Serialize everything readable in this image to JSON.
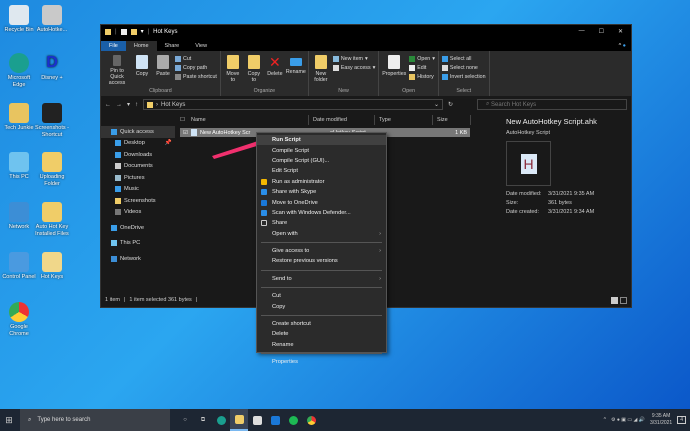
{
  "desktop": {
    "icons": [
      "Recycle Bin",
      "AutoHotke...",
      "Microsoft Edge",
      "Disney +",
      "Tech Junkie",
      "Screenshots - Shortcut",
      "This PC",
      "Uploading Folder",
      "Network",
      "Auto Hot Key Installed Files",
      "Control Panel",
      "Hot Keys",
      "Google Chrome"
    ]
  },
  "window": {
    "title": "Hot Keys",
    "tabs": [
      "File",
      "Home",
      "Share",
      "View"
    ],
    "ribbon": {
      "clipboard": {
        "label": "Clipboard",
        "pin": "Pin to Quick access",
        "copy": "Copy",
        "paste": "Paste",
        "cut": "Cut",
        "copy_path": "Copy path",
        "paste_shortcut": "Paste shortcut"
      },
      "organize": {
        "label": "Organize",
        "move_to": "Move to",
        "copy_to": "Copy to",
        "delete": "Delete",
        "rename": "Rename"
      },
      "new": {
        "label": "New",
        "new_folder": "New folder",
        "new_item": "New item",
        "easy_access": "Easy access"
      },
      "open": {
        "label": "Open",
        "properties": "Properties",
        "open": "Open",
        "edit": "Edit",
        "history": "History"
      },
      "select": {
        "label": "Select",
        "select_all": "Select all",
        "select_none": "Select none",
        "invert": "Invert selection"
      }
    },
    "address": {
      "path": "Hot Keys",
      "search_placeholder": "Search Hot Keys"
    },
    "nav": {
      "items": [
        "Quick access",
        "Desktop",
        "Downloads",
        "Documents",
        "Pictures",
        "Music",
        "Screenshots",
        "Videos",
        "OneDrive",
        "This PC",
        "Network"
      ]
    },
    "columns": [
      "Name",
      "Date modified",
      "Type",
      "Size"
    ],
    "file": {
      "name": "New AutoHotkey Script.ahk",
      "name_visible": "New AutoHotkey Scr",
      "type": "AutoHotkey Script",
      "type_visible": "oHotkey Script",
      "size": "1 KB"
    },
    "preview": {
      "title": "New AutoHotkey Script.ahk",
      "subtitle": "AutoHotkey Script",
      "date_modified_label": "Date modified:",
      "date_modified": "3/31/2021 9:35 AM",
      "size_label": "Size:",
      "size": "361 bytes",
      "date_created_label": "Date created:",
      "date_created": "3/31/2021 9:34 AM"
    },
    "status": {
      "count": "1 item",
      "selected": "1 item selected  361 bytes"
    }
  },
  "context_menu": {
    "items": [
      "Run Script",
      "Compile Script",
      "Compile Script (GUI)...",
      "Edit Script",
      "Run as administrator",
      "Share with Skype",
      "Move to OneDrive",
      "Scan with Windows Defender...",
      "Share",
      "Open with",
      "Give access to",
      "Restore previous versions",
      "Send to",
      "Cut",
      "Copy",
      "Create shortcut",
      "Delete",
      "Rename",
      "Properties"
    ]
  },
  "taskbar": {
    "search_placeholder": "Type here to search",
    "time": "9:35 AM",
    "date": "3/31/2021",
    "notification_count": "4"
  },
  "colors": {
    "accent": "#1a5fa8",
    "arrow": "#f0306e"
  }
}
